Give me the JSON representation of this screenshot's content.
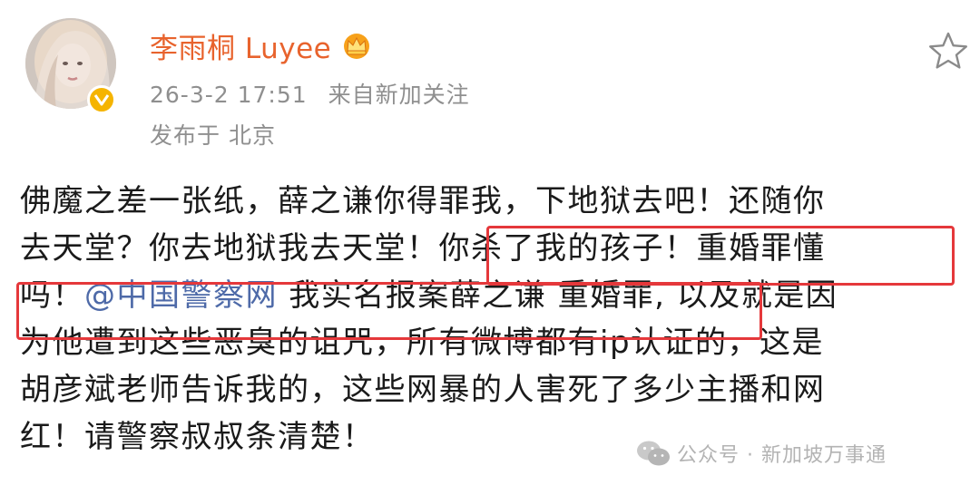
{
  "user": {
    "name": "李雨桐 Luyee",
    "timestamp": "26-3-2 17:51",
    "source": "来自新加关注",
    "location": "发布于 北京"
  },
  "post": {
    "line1": "佛魔之差一张纸，薛之谦你得罪我，下地狱去吧！还随你",
    "line2a": "去天堂？你去地狱我去天堂！",
    "line2b": "你杀了我的孩子！重婚罪懂",
    "line3a": "吗！",
    "line3_mention": "@中国警察网",
    "line3b": " 我实名报案薛之谦 重婚罪,",
    "line3c": " 以及就是因",
    "line4": "为他遭到这些恶臭的诅咒，所有微博都有ip认证的，这是",
    "line5": "胡彦斌老师告诉我的，这些网暴的人害死了多少主播和网",
    "line6": "红！请警察叔叔条清楚！"
  },
  "watermark": {
    "text": "公众号 · 新加坡万事通"
  },
  "colors": {
    "username": "#e8632d",
    "meta": "#8f8f8f",
    "mention": "#4e6aa8",
    "highlight_box": "#e5383b",
    "verified_badge": "#f5b400"
  },
  "icons": [
    "avatar",
    "verified-badge-icon",
    "crown-vip-icon",
    "star-favorite-icon",
    "wechat-icon"
  ]
}
